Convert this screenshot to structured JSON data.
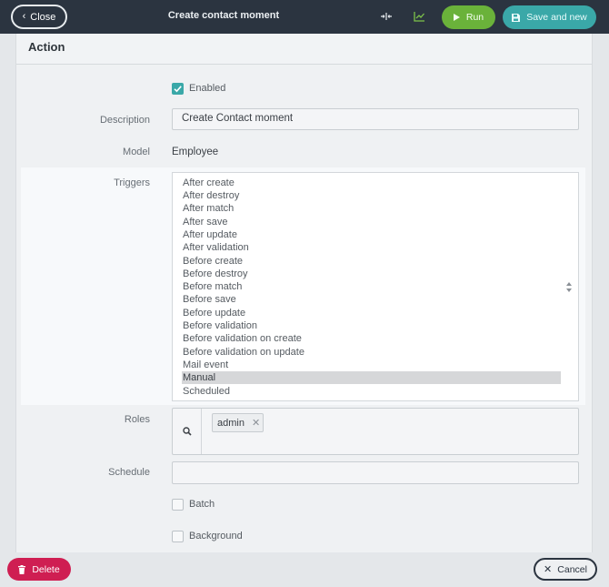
{
  "topbar": {
    "close_label": "Close",
    "title": "Create contact moment",
    "run_label": "Run",
    "save_and_new_label": "Save and new"
  },
  "panel": {
    "heading": "Action"
  },
  "form": {
    "enabled": {
      "label": "Enabled",
      "checked": true
    },
    "description": {
      "label": "Description",
      "value": "Create Contact moment"
    },
    "model": {
      "label": "Model",
      "value": "Employee"
    },
    "triggers": {
      "label": "Triggers",
      "options": [
        "After create",
        "After destroy",
        "After match",
        "After save",
        "After update",
        "After validation",
        "Before create",
        "Before destroy",
        "Before match",
        "Before save",
        "Before update",
        "Before validation",
        "Before validation on create",
        "Before validation on update",
        "Mail event",
        "Manual",
        "Scheduled"
      ],
      "selected": "Manual"
    },
    "roles": {
      "label": "Roles",
      "tags": [
        "admin"
      ]
    },
    "schedule": {
      "label": "Schedule",
      "value": ""
    },
    "batch": {
      "label": "Batch",
      "checked": false
    },
    "background": {
      "label": "Background",
      "checked": false
    }
  },
  "footer": {
    "delete_label": "Delete",
    "cancel_label": "Cancel"
  },
  "colors": {
    "topbar": "#2b3440",
    "run": "#6ab23a",
    "save_and_new": "#3aa8a8",
    "delete": "#cf1e52",
    "checkbox_on": "#3aa8a8"
  },
  "icons": {
    "close": "chevron-left-icon",
    "compress": "compress-arrows-icon",
    "chart": "line-chart-icon",
    "run": "play-icon",
    "save": "floppy-disk-icon",
    "roles_search": "search-icon",
    "tag_remove": "close-icon",
    "delete": "trash-icon",
    "cancel": "close-icon"
  }
}
